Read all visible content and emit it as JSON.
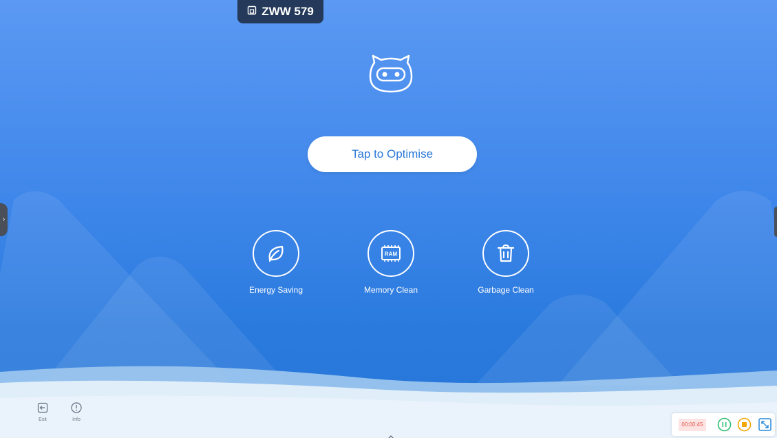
{
  "device_badge": {
    "icon": "screen-share-icon",
    "label": "ZWW 579"
  },
  "robot": {
    "icon": "robot-mascot-icon"
  },
  "main": {
    "optimise_label": "Tap to Optimise"
  },
  "tools": [
    {
      "label": "Energy Saving",
      "icon": "leaf-icon"
    },
    {
      "label": "Memory Clean",
      "icon": "ram-chip-icon",
      "chip_text": "RAM"
    },
    {
      "label": "Garbage Clean",
      "icon": "trash-icon"
    }
  ],
  "bottom_left": [
    {
      "label": "Exit",
      "icon": "exit-icon"
    },
    {
      "label": "Info",
      "icon": "info-icon"
    }
  ],
  "recorder": {
    "time": "00:00:45",
    "pause_icon": "pause-icon",
    "stop_icon": "stop-icon",
    "expand_icon": "expand-icon",
    "colors": {
      "time": "#e5534b",
      "pause": "#2fbf71",
      "stop": "#f2a600",
      "expand": "#2a8ad8"
    }
  },
  "colors": {
    "accent": "#2a78d8",
    "background_top": "#5b99f3",
    "background_bottom": "#2777d9"
  }
}
